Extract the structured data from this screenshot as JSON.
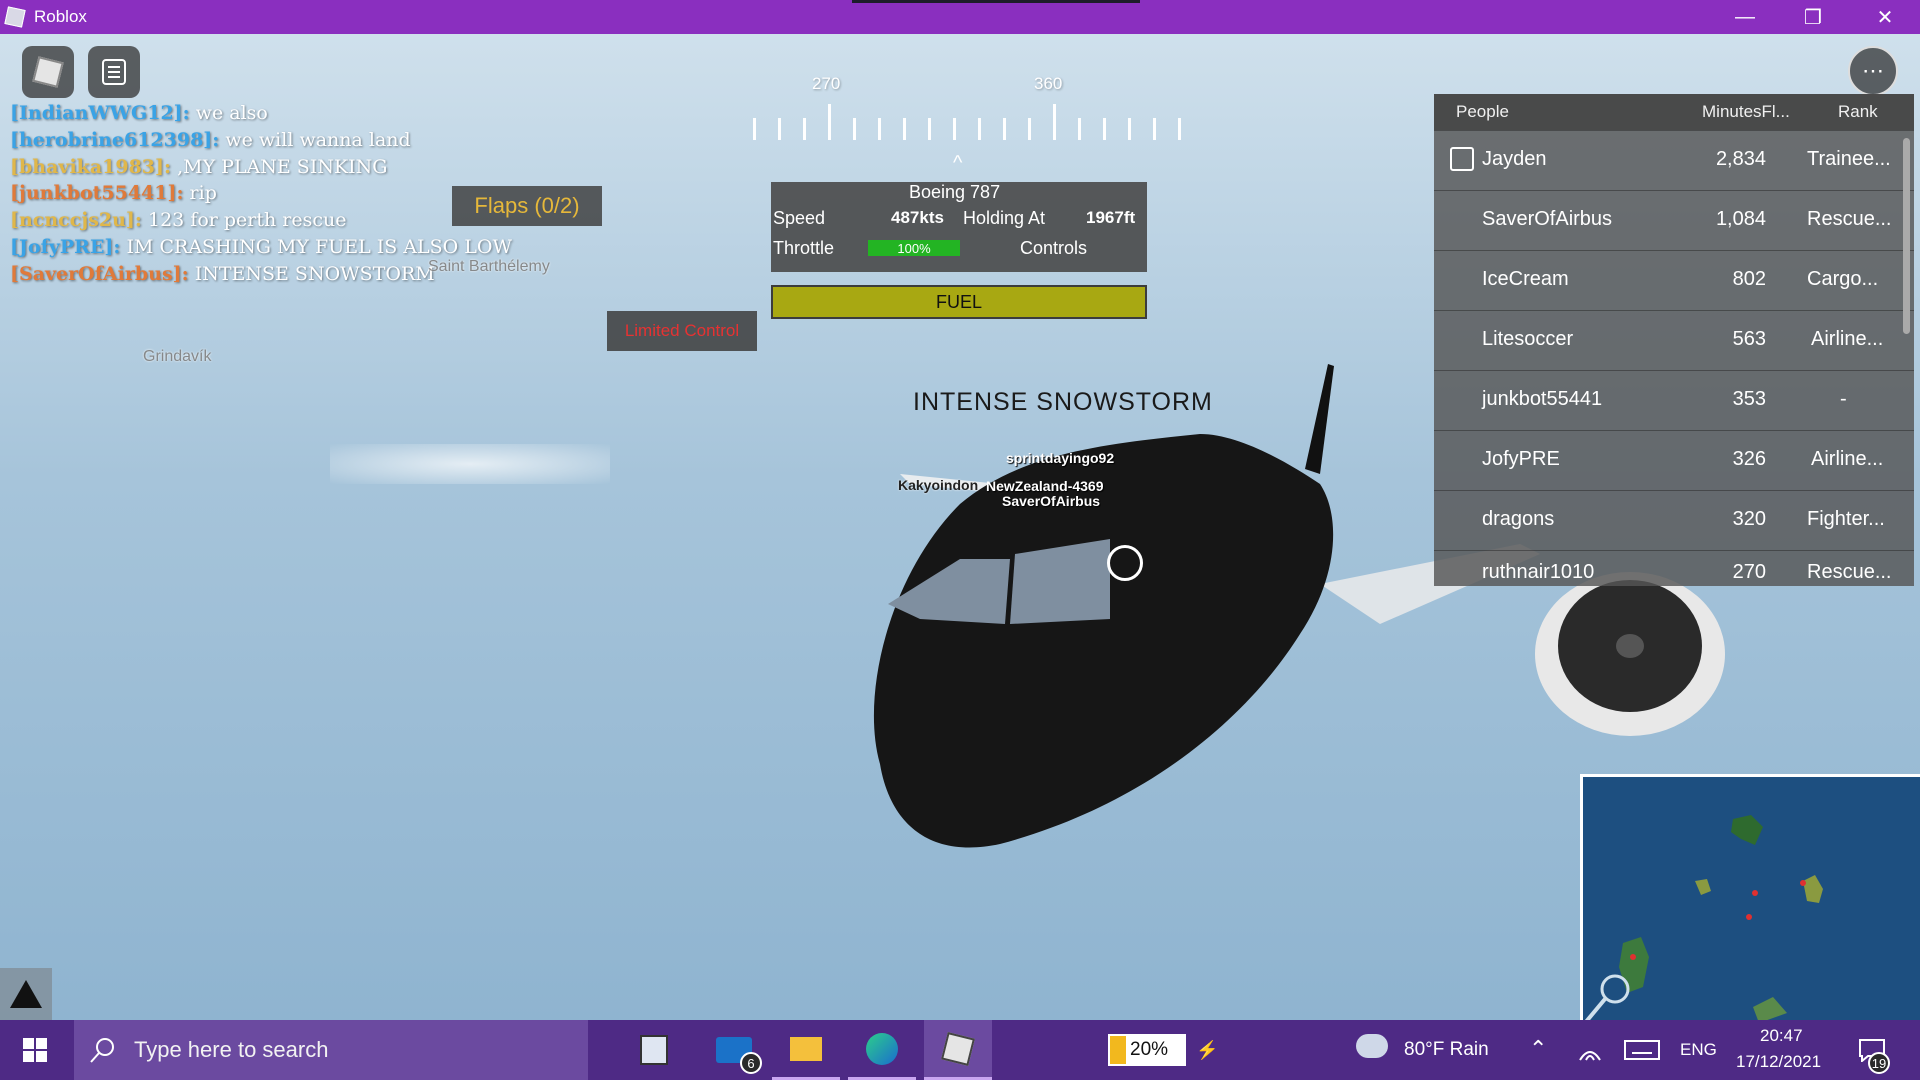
{
  "window": {
    "title": "Roblox"
  },
  "chat": {
    "messages": [
      {
        "name": "[IndianWWG12]:",
        "text": "we also",
        "color": "#3aa3e6"
      },
      {
        "name": "[herobrine612398]:",
        "text": "we will wanna land",
        "color": "#3aa3e6"
      },
      {
        "name": "[bhavika1983]:",
        "text": ",MY PLANE SINKING",
        "color": "#e0b74a"
      },
      {
        "name": "[junkbot55441]:",
        "text": "rip",
        "color": "#e07a3a"
      },
      {
        "name": "[ncnccjs2u]:",
        "text": "123 for perth rescue",
        "color": "#e0b74a"
      },
      {
        "name": "[JofyPRE]:",
        "text": "IM CRASHING MY FUEL IS ALSO LOW",
        "color": "#3aa3e6"
      },
      {
        "name": "[SaverOfAirbus]:",
        "text": "INTENSE SNOWSTORM",
        "color": "#e07a3a"
      }
    ]
  },
  "world_labels": {
    "saint_barth": "Saint Barthélemy",
    "grindavik": "Grindavík"
  },
  "compass": {
    "left_heading": "270",
    "right_heading": "360"
  },
  "flight": {
    "flaps": "Flaps (0/2)",
    "limited_control": "Limited Control",
    "aircraft": "Boeing 787",
    "speed_label": "Speed",
    "speed_value": "487kts",
    "holding_label": "Holding At",
    "holding_value": "1967ft",
    "throttle_label": "Throttle",
    "throttle_value": "100%",
    "controls_label": "Controls",
    "fuel_label": "FUEL"
  },
  "plane": {
    "overhead_label": "INTENSE SNOWSTORM",
    "players": [
      "sprintdayingo92",
      "Kakyoindon",
      "NewZealand-4369",
      "SaverOfAirbus"
    ]
  },
  "leaderboard": {
    "headers": {
      "people": "People",
      "minutes": "MinutesFl...",
      "rank": "Rank"
    },
    "rows": [
      {
        "name": "Jayden",
        "minutes": "2,834",
        "rank": "Trainee..."
      },
      {
        "name": "SaverOfAirbus",
        "minutes": "1,084",
        "rank": "Rescue..."
      },
      {
        "name": "IceCream",
        "minutes": "802",
        "rank": "Cargo..."
      },
      {
        "name": "Litesoccer",
        "minutes": "563",
        "rank": "Airline..."
      },
      {
        "name": "junkbot55441",
        "minutes": "353",
        "rank": "-"
      },
      {
        "name": "JofyPRE",
        "minutes": "326",
        "rank": "Airline..."
      },
      {
        "name": "dragons",
        "minutes": "320",
        "rank": "Fighter..."
      },
      {
        "name": "ruthnair1010",
        "minutes": "270",
        "rank": "Rescue..."
      }
    ]
  },
  "taskbar": {
    "search_placeholder": "Type here to search",
    "mail_badge": "6",
    "battery": "20%",
    "weather": "80°F  Rain",
    "language": "ENG",
    "time": "20:47",
    "date": "17/12/2021",
    "notification_badge": "19"
  }
}
